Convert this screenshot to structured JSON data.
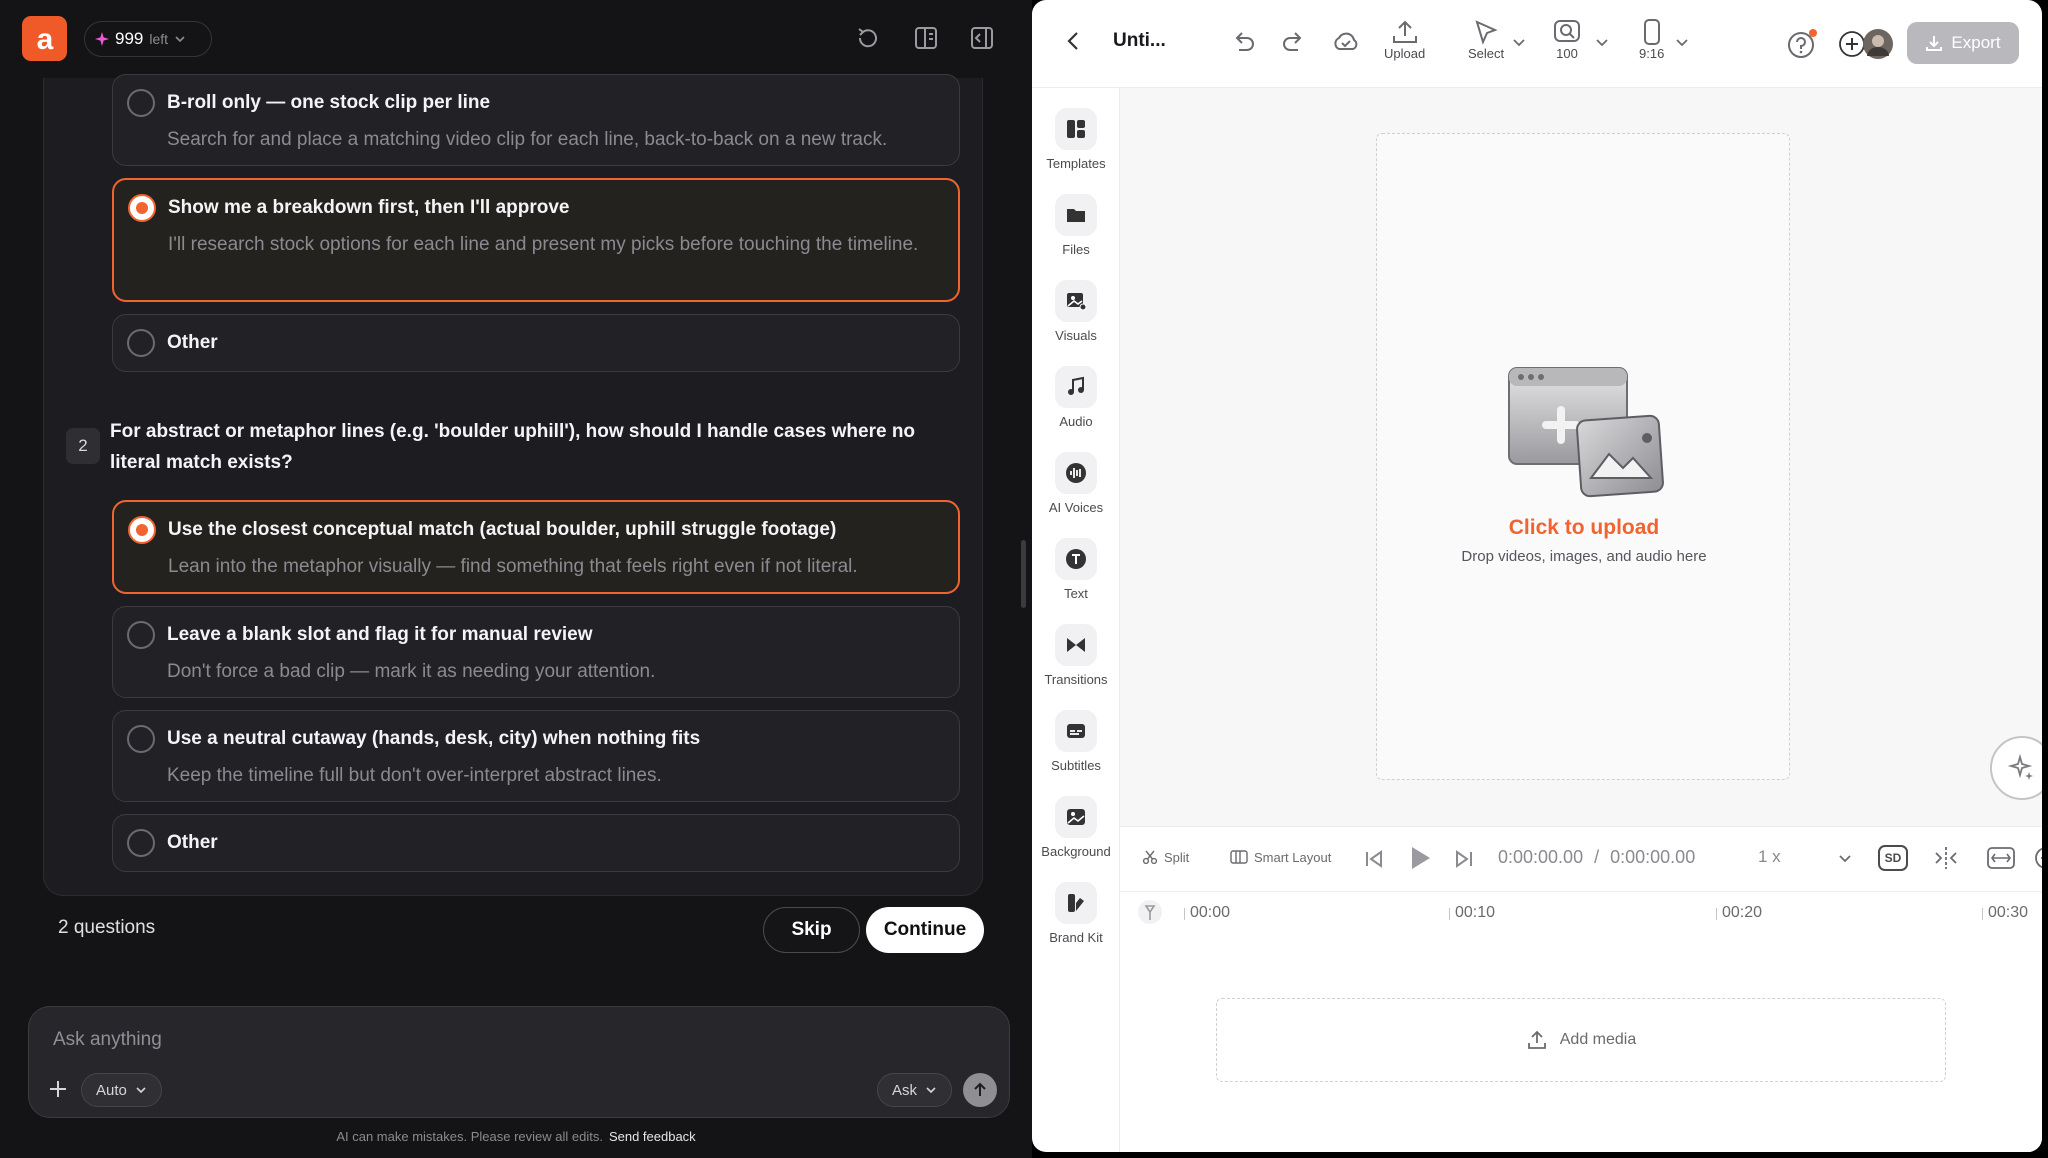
{
  "app": {
    "credits_count": "999",
    "credits_label": "left"
  },
  "questions": {
    "q1_options": [
      {
        "title": "B-roll only — one stock clip per line",
        "desc": "Search for and place a matching video clip for each line, back-to-back on a new track.",
        "selected": false
      },
      {
        "title": "Show me a breakdown first, then I'll approve",
        "desc": "I'll research stock options for each line and present my picks before touching the timeline.",
        "selected": true
      },
      {
        "title": "Other",
        "desc": "",
        "selected": false
      }
    ],
    "q2_number": "2",
    "q2_text": "For abstract or metaphor lines (e.g. 'boulder uphill'), how should I handle cases where no literal match exists?",
    "q2_options": [
      {
        "title": "Use the closest conceptual match (actual boulder, uphill struggle footage)",
        "desc": "Lean into the metaphor visually — find something that feels right even if not literal.",
        "selected": true
      },
      {
        "title": "Leave a blank slot and flag it for manual review",
        "desc": "Don't force a bad clip — mark it as needing your attention.",
        "selected": false
      },
      {
        "title": "Use a neutral cutaway (hands, desk, city) when nothing fits",
        "desc": "Keep the timeline full but don't over-interpret abstract lines.",
        "selected": false
      },
      {
        "title": "Other",
        "desc": "",
        "selected": false
      }
    ],
    "count_label": "2 questions",
    "skip_label": "Skip",
    "continue_label": "Continue"
  },
  "composer": {
    "placeholder": "Ask anything",
    "mode_label": "Auto",
    "ask_label": "Ask",
    "footnote": "AI can make mistakes. Please review all edits.",
    "feedback_label": "Send feedback"
  },
  "editor": {
    "title": "Unti...",
    "tools": {
      "upload": "Upload",
      "select": "Select",
      "zoom": "100",
      "aspect": "9:16"
    },
    "export_label": "Export",
    "sidebar": [
      "Templates",
      "Files",
      "Visuals",
      "Audio",
      "AI Voices",
      "Text",
      "Transitions",
      "Subtitles",
      "Background",
      "Brand Kit"
    ],
    "upload_title": "Click to upload",
    "upload_sub": "Drop videos, images, and audio here",
    "transport": {
      "split": "Split",
      "smart_layout": "Smart Layout",
      "time_current": "0:00:00.00",
      "time_sep": "/",
      "time_total": "0:00:00.00",
      "speed": "1 x",
      "quality": "SD"
    },
    "ticks": [
      "00:00",
      "00:10",
      "00:20",
      "00:30"
    ],
    "add_media": "Add media"
  },
  "colors": {
    "accent": "#f0652f",
    "dark_bg": "#141416",
    "export_bg": "#b9b9bd"
  }
}
